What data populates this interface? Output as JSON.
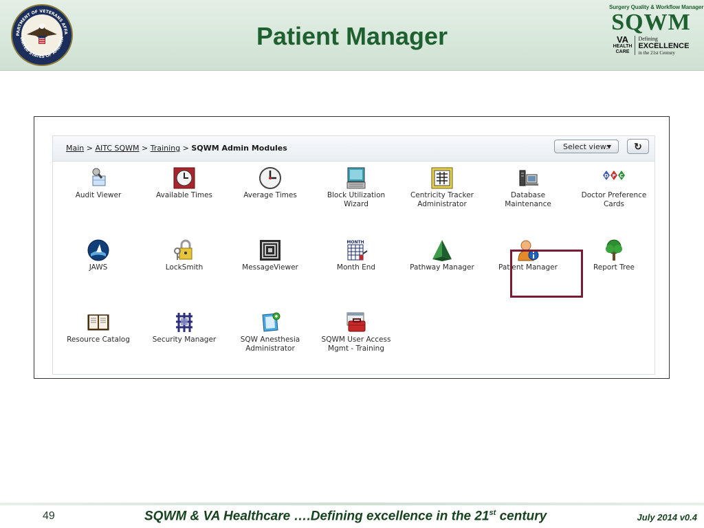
{
  "slide": {
    "title": "Patient Manager",
    "page_number": "49",
    "footer_prefix": "SQWM & VA Healthcare ….Defining excellence in the 21",
    "footer_sup": "st",
    "footer_suffix": " century",
    "footer_date": "July 2014 v0.4"
  },
  "seal": {
    "top_text": "DEPARTMENT OF VETERANS AFFAIRS",
    "bottom_text": "UNITED STATES OF AMERICA"
  },
  "brand": {
    "small": "Surgery Quality & Workflow Manager",
    "big": "SQWM",
    "va": "VA",
    "va_sub1": "HEALTH",
    "va_sub2": "CARE",
    "def1": "Defining",
    "def2": "EXCELLENCE",
    "def3": "in the 21st Century"
  },
  "breadcrumb": {
    "main": "Main",
    "sep": " > ",
    "aitc": "AITC SQWM",
    "training": "Training",
    "current": "SQWM Admin Modules"
  },
  "toolbar": {
    "select_view": "Select view:",
    "refresh_icon": "refresh-icon"
  },
  "modules": [
    {
      "label": "Audit Viewer",
      "icon": "audit-viewer-icon"
    },
    {
      "label": "Available Times",
      "icon": "available-times-icon"
    },
    {
      "label": "Average Times",
      "icon": "average-times-icon"
    },
    {
      "label": "Block Utilization\nWizard",
      "icon": "block-utilization-icon"
    },
    {
      "label": "Centricity Tracker\nAdministrator",
      "icon": "centricity-tracker-icon"
    },
    {
      "label": "Database\nMaintenance",
      "icon": "database-maintenance-icon"
    },
    {
      "label": "Doctor Preference\nCards",
      "icon": "doctor-preference-icon"
    },
    {
      "label": "JAWS",
      "icon": "jaws-icon"
    },
    {
      "label": "LockSmith",
      "icon": "locksmith-icon"
    },
    {
      "label": "MessageViewer",
      "icon": "message-viewer-icon"
    },
    {
      "label": "Month End",
      "icon": "month-end-icon"
    },
    {
      "label": "Pathway Manager",
      "icon": "pathway-manager-icon"
    },
    {
      "label": "Patient Manager",
      "icon": "patient-manager-icon",
      "selected": true
    },
    {
      "label": "Report Tree",
      "icon": "report-tree-icon"
    },
    {
      "label": "Resource Catalog",
      "icon": "resource-catalog-icon"
    },
    {
      "label": "Security Manager",
      "icon": "security-manager-icon"
    },
    {
      "label": "SQW Anesthesia\nAdministrator",
      "icon": "sqw-anesthesia-icon"
    },
    {
      "label": "SQWM User Access\nMgmt - Training",
      "icon": "sqwm-user-access-icon"
    }
  ],
  "month_end_icon_text": "MONTH",
  "doctor_pref_letters": [
    "D",
    "P",
    "C"
  ],
  "colors": {
    "title_green": "#1f6030",
    "selection_border": "#7a1b36",
    "header_bg": "#d7e7da"
  }
}
